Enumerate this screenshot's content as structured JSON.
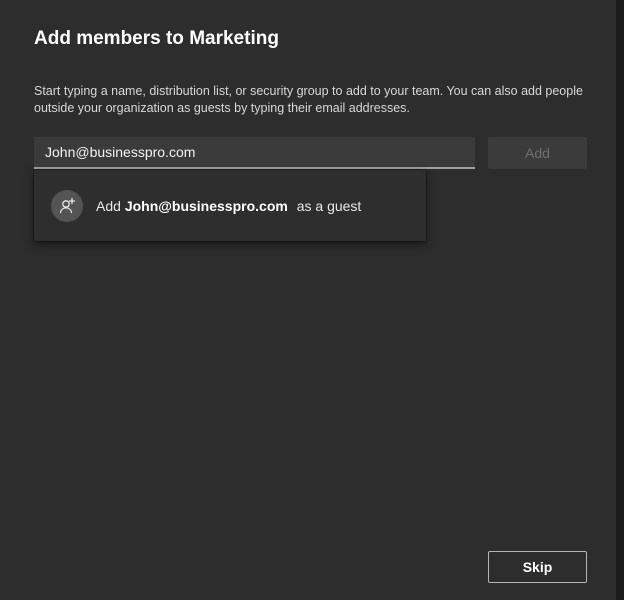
{
  "dialog": {
    "title": "Add members to Marketing",
    "description": "Start typing a name, distribution list, or security group to add to your team. You can also add people outside your organization as guests by typing their email addresses."
  },
  "input": {
    "value": "John@businesspro.com"
  },
  "add_button": {
    "label": "Add",
    "disabled": true
  },
  "suggestion": {
    "icon": "add-guest-icon",
    "prefix": "Add",
    "email": "John@businesspro.com",
    "suffix": "as a guest"
  },
  "skip_button": {
    "label": "Skip"
  },
  "colors": {
    "dialog_bg": "#2d2d2d",
    "input_bg": "#3b3b3b",
    "text": "#ffffff",
    "disabled_text": "#6e6e6e"
  }
}
